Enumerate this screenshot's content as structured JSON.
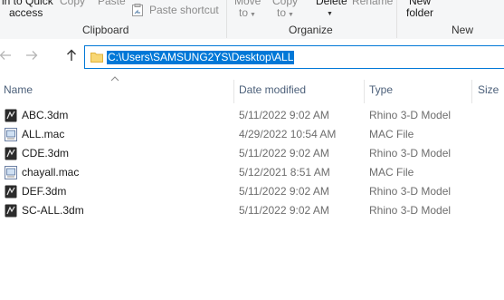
{
  "ribbon": {
    "quick_access": [
      "in to Quick",
      "access"
    ],
    "copy": "Copy",
    "paste": "Paste",
    "paste_shortcut": "Paste shortcut",
    "move_to": [
      "Move",
      "to"
    ],
    "copy_to": [
      "Copy",
      "to"
    ],
    "delete": "Delete",
    "rename": "Rename",
    "new_folder": [
      "New",
      "folder"
    ],
    "groups": {
      "clipboard": "Clipboard",
      "organize": "Organize",
      "new": "New"
    }
  },
  "address": {
    "path": "C:\\Users\\SAMSUNG2YS\\Desktop\\ALL"
  },
  "columns": {
    "name": "Name",
    "date": "Date modified",
    "type": "Type",
    "size": "Size"
  },
  "files": [
    {
      "name": "ABC.3dm",
      "date": "5/11/2022 9:02 AM",
      "type": "Rhino 3-D Model",
      "icon": "rhino-model-icon"
    },
    {
      "name": "ALL.mac",
      "date": "4/29/2022 10:54 AM",
      "type": "MAC File",
      "icon": "mac-file-icon"
    },
    {
      "name": "CDE.3dm",
      "date": "5/11/2022 9:02 AM",
      "type": "Rhino 3-D Model",
      "icon": "rhino-model-icon"
    },
    {
      "name": "chayall.mac",
      "date": "5/12/2021 8:51 AM",
      "type": "MAC File",
      "icon": "mac-file-icon"
    },
    {
      "name": "DEF.3dm",
      "date": "5/11/2022 9:02 AM",
      "type": "Rhino 3-D Model",
      "icon": "rhino-model-icon"
    },
    {
      "name": "SC-ALL.3dm",
      "date": "5/11/2022 9:02 AM",
      "type": "Rhino 3-D Model",
      "icon": "rhino-model-icon"
    }
  ],
  "colors": {
    "accent": "#0078d7",
    "header_text": "#4c607a",
    "meta_text": "#6d6d6d"
  }
}
